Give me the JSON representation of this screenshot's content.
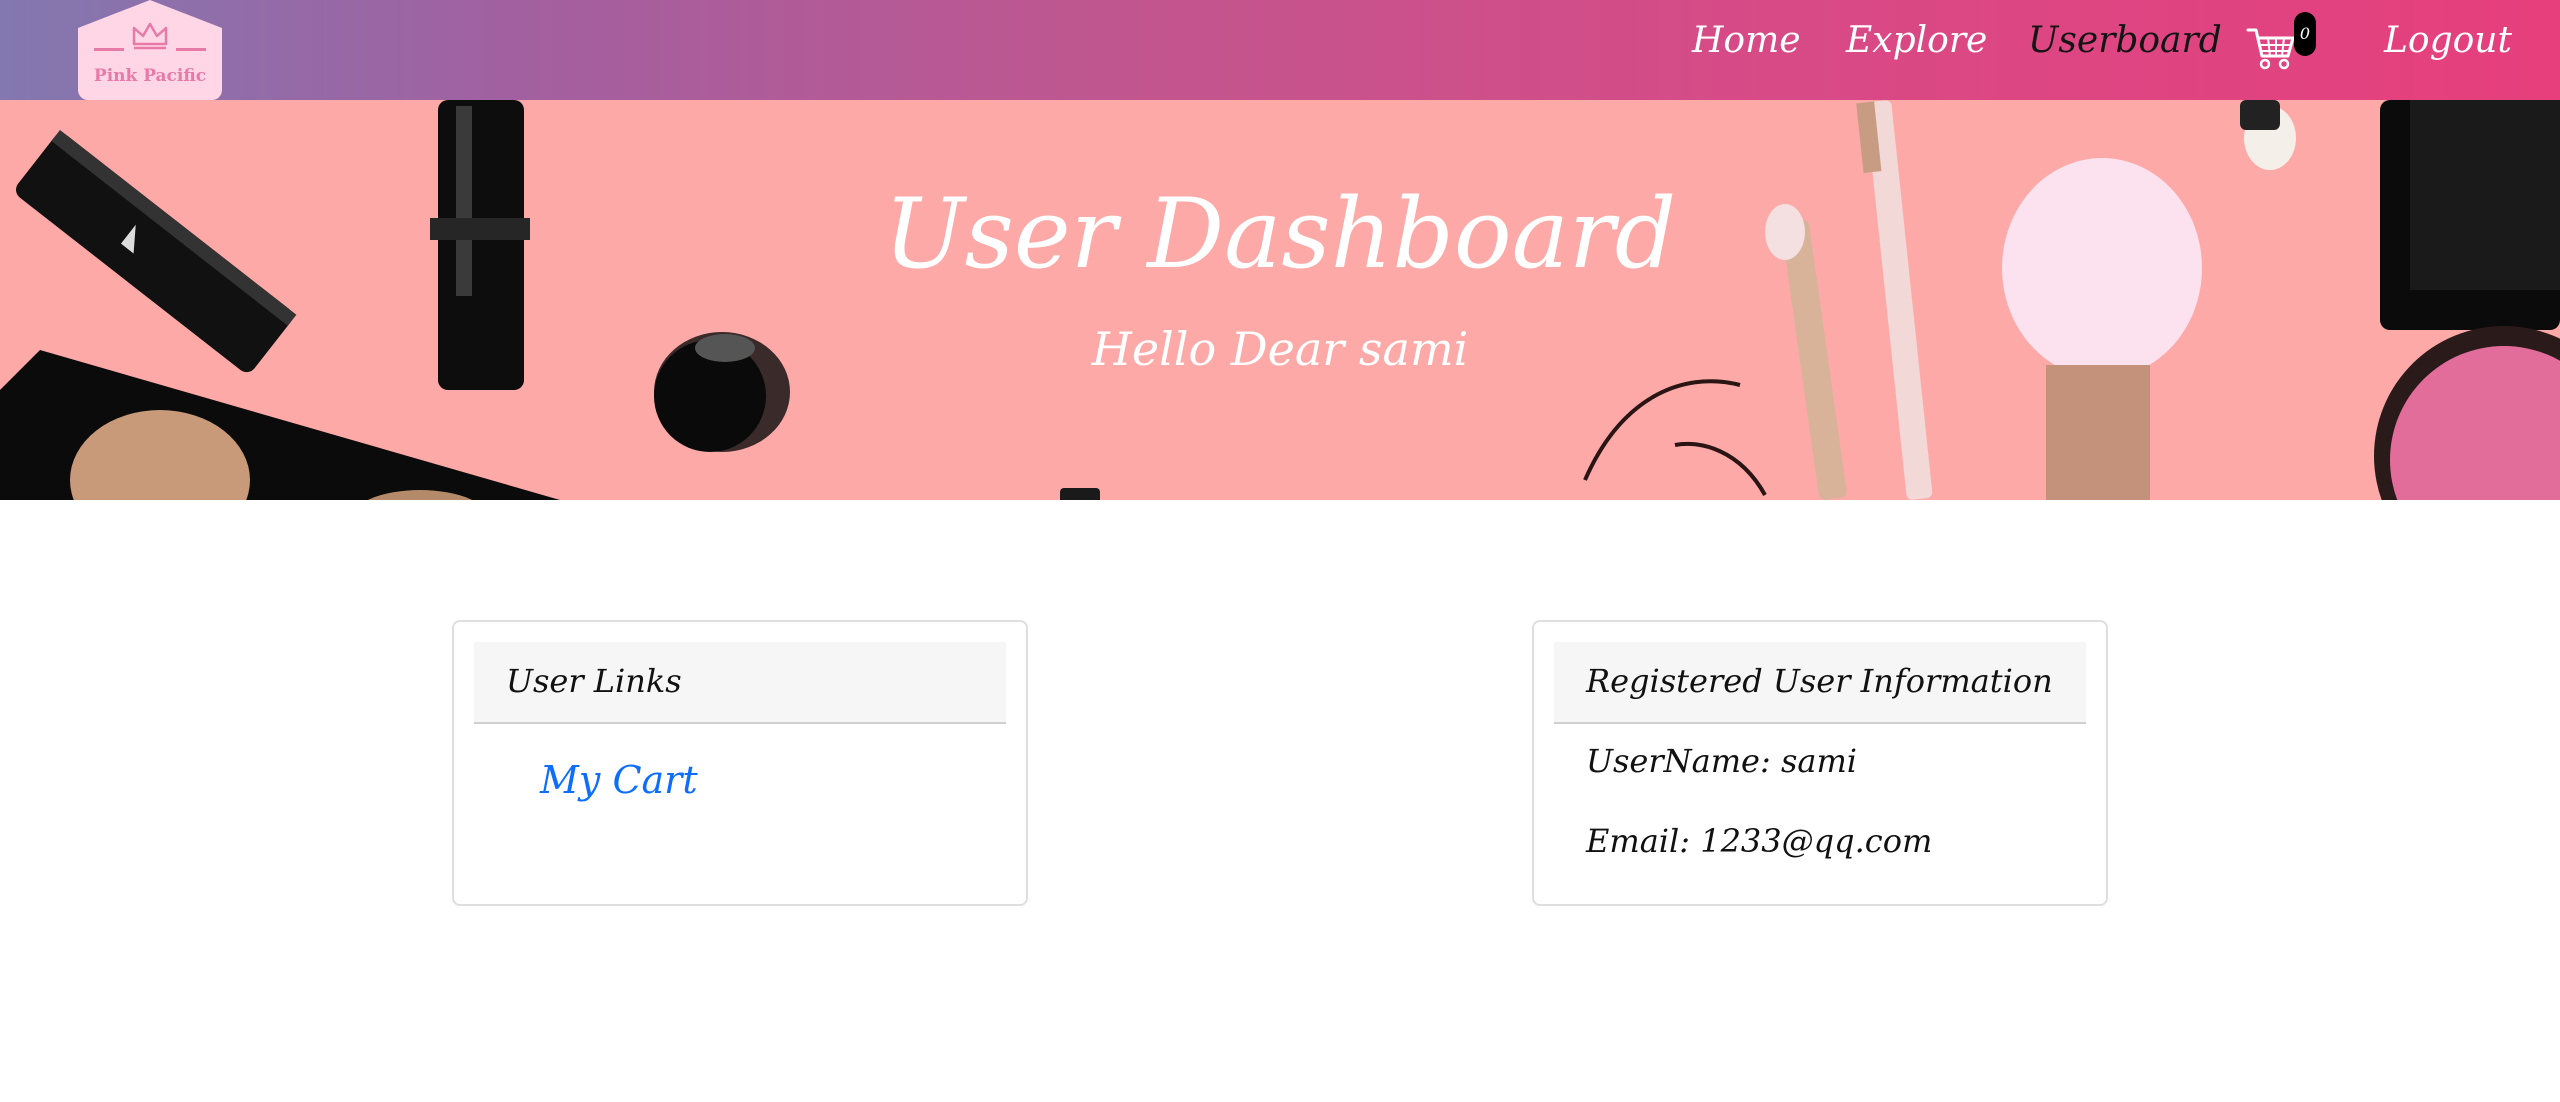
{
  "brand": {
    "name": "Pink Pacific",
    "logo_icon": "crown-icon"
  },
  "nav": {
    "items": [
      {
        "label": "Home"
      },
      {
        "label": "Explore"
      },
      {
        "label": "Userboard",
        "active": true
      },
      {
        "label": "Logout"
      }
    ],
    "cart": {
      "icon": "cart-icon",
      "count": "0"
    }
  },
  "hero": {
    "title": "User Dashboard",
    "subtitle": "Hello Dear sami"
  },
  "user_links": {
    "header": "User Links",
    "links": [
      {
        "label": "My Cart"
      }
    ]
  },
  "user_info": {
    "header": "Registered User Information",
    "username_line": "UserName: sami",
    "email_line": "Email: 1233@qq.com"
  },
  "colors": {
    "nav_gradient_start": "#8378b0",
    "nav_gradient_end": "#e63f7c",
    "hero_background": "#fda9a7",
    "link_blue": "#0d6efd",
    "active_nav": "#141414"
  }
}
